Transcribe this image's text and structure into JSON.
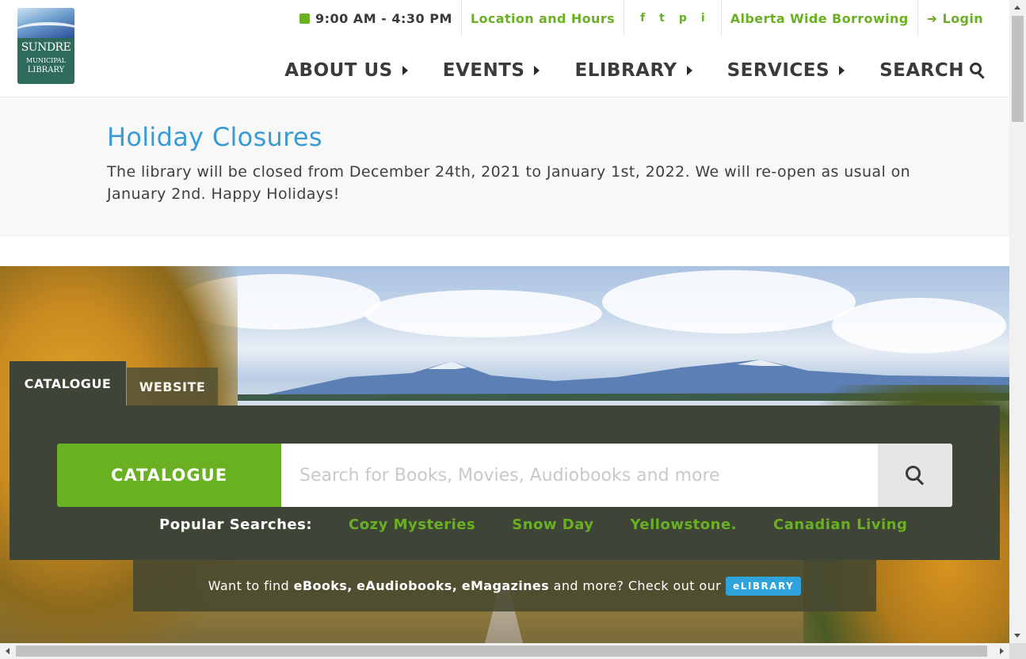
{
  "logo": {
    "line1": "SUNDRE",
    "line2": "MUNICIPAL",
    "line3": "LIBRARY"
  },
  "topbar": {
    "hours": "9:00 AM - 4:30 PM",
    "location_link": "Location and Hours",
    "social_icons": [
      "facebook-icon",
      "twitter-icon",
      "pinterest-icon",
      "instagram-icon"
    ],
    "social_glyphs": [
      "f",
      "t",
      "p",
      "i"
    ],
    "borrowing_link": "Alberta Wide Borrowing",
    "login_link": "Login"
  },
  "nav": {
    "items": [
      "ABOUT US",
      "EVENTS",
      "ELIBRARY",
      "SERVICES"
    ],
    "search": "SEARCH"
  },
  "alert": {
    "title": "Holiday Closures",
    "body": "The library will be closed from December 24th, 2021 to January 1st, 2022. We will re-open as usual on January 2nd. Happy Holidays!"
  },
  "search": {
    "tabs": [
      "CATALOGUE",
      "WEBSITE"
    ],
    "scope_button": "CATALOGUE",
    "placeholder": "Search for Books, Movies, Audiobooks and more",
    "popular_label": "Popular Searches:",
    "popular_queries": [
      "Cozy Mysteries",
      "Snow Day",
      "Yellowstone.",
      "Canadian Living"
    ]
  },
  "ebar": {
    "prefix": "Want to find",
    "bold1": "eBooks,",
    "bold2": "eAudiobooks,",
    "bold3": "eMagazines",
    "suffix": "and more? Check out our",
    "badge": "eLIBRARY"
  },
  "colors": {
    "accent_green": "#6ab023",
    "alert_blue": "#3a9bd3",
    "panel_dark": "#3e4436",
    "badge_blue": "#2ea3dc"
  }
}
